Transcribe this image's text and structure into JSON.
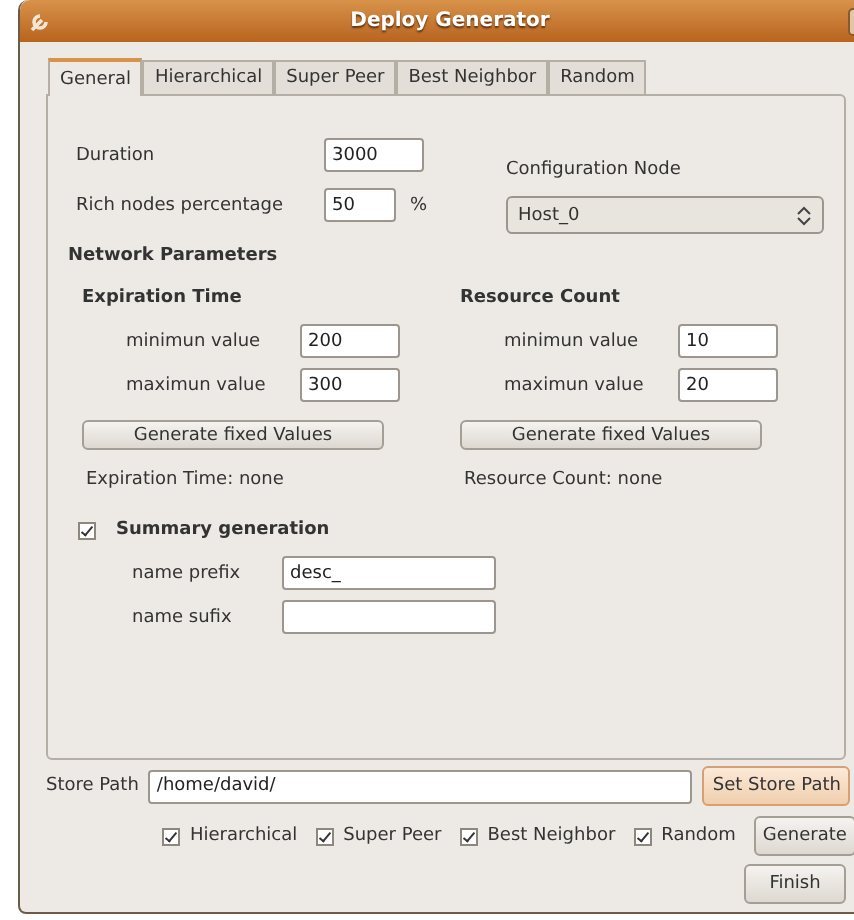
{
  "window": {
    "title": "Deploy Generator"
  },
  "tabs": [
    {
      "label": "General",
      "selected": true
    },
    {
      "label": "Hierarchical",
      "selected": false
    },
    {
      "label": "Super Peer",
      "selected": false
    },
    {
      "label": "Best Neighbor",
      "selected": false
    },
    {
      "label": "Random",
      "selected": false
    }
  ],
  "general": {
    "duration": {
      "label": "Duration",
      "value": "3000"
    },
    "rich_nodes": {
      "label": "Rich nodes percentage",
      "value": "50",
      "unit": "%"
    },
    "configuration_node": {
      "label": "Configuration Node",
      "value": "Host_0"
    }
  },
  "network_parameters": {
    "title": "Network Parameters",
    "groups": [
      {
        "title": "Expiration Time",
        "min_label": "minimun value",
        "min": "200",
        "max_label": "maximun value",
        "max": "300",
        "button": "Generate fixed Values",
        "result": "Expiration Time: none"
      },
      {
        "title": "Resource Count",
        "min_label": "minimun value",
        "min": "10",
        "max_label": "maximun value",
        "max": "20",
        "button": "Generate fixed Values",
        "result": "Resource Count: none"
      }
    ]
  },
  "summary": {
    "label": "Summary generation",
    "checked": true,
    "prefix_label": "name prefix",
    "prefix": "desc_",
    "suffix_label": "name sufix"
  },
  "store_path": {
    "label": "Store Path",
    "value": "/home/david/",
    "button": "Set Store Path"
  },
  "options": [
    {
      "label": "Hierarchical",
      "checked": true
    },
    {
      "label": "Super Peer",
      "checked": true
    },
    {
      "label": "Best Neighbor",
      "checked": true
    },
    {
      "label": "Random",
      "checked": true
    }
  ],
  "buttons": {
    "generate": "Generate",
    "finish": "Finish"
  }
}
